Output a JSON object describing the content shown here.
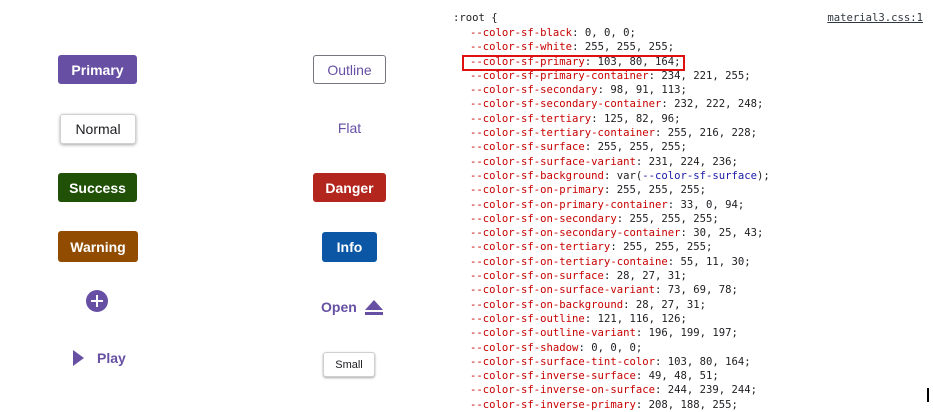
{
  "buttons": {
    "primary": "Primary",
    "normal": "Normal",
    "success": "Success",
    "warning": "Warning",
    "outline": "Outline",
    "flat": "Flat",
    "danger": "Danger",
    "info": "Info",
    "open": "Open",
    "play": "Play",
    "small": "Small"
  },
  "icons": {
    "add": "add-circle-icon",
    "play": "play-icon",
    "open": "eject-icon"
  },
  "colors": {
    "primary": "#6750a4",
    "success": "#205107",
    "warning": "#914c00",
    "danger": "#b3261e",
    "info": "#0b57a5"
  },
  "styles": {
    "selector": ":root {",
    "source": "material3.css:1",
    "highlighted_index": 2,
    "declarations": [
      {
        "prop": "--color-sf-black",
        "val": "0, 0, 0;"
      },
      {
        "prop": "--color-sf-white",
        "val": "255, 255, 255;"
      },
      {
        "prop": "--color-sf-primary",
        "val": "103, 80, 164;"
      },
      {
        "prop": "--color-sf-primary-container",
        "val": "234, 221, 255;"
      },
      {
        "prop": "--color-sf-secondary",
        "val": "98, 91, 113;"
      },
      {
        "prop": "--color-sf-secondary-container",
        "val": "232, 222, 248;"
      },
      {
        "prop": "--color-sf-tertiary",
        "val": "125, 82, 96;"
      },
      {
        "prop": "--color-sf-tertiary-container",
        "val": "255, 216, 228;"
      },
      {
        "prop": "--color-sf-surface",
        "val": "255, 255, 255;"
      },
      {
        "prop": "--color-sf-surface-variant",
        "val": "231, 224, 236;"
      },
      {
        "prop": "--color-sf-background",
        "val": "var(--color-sf-surface);"
      },
      {
        "prop": "--color-sf-on-primary",
        "val": "255, 255, 255;"
      },
      {
        "prop": "--color-sf-on-primary-container",
        "val": "33, 0, 94;"
      },
      {
        "prop": "--color-sf-on-secondary",
        "val": "255, 255, 255;"
      },
      {
        "prop": "--color-sf-on-secondary-container",
        "val": "30, 25, 43;"
      },
      {
        "prop": "--color-sf-on-tertiary",
        "val": "255, 255, 255;"
      },
      {
        "prop": "--color-sf-on-tertiary-containe",
        "val": "55, 11, 30;"
      },
      {
        "prop": "--color-sf-on-surface",
        "val": "28, 27, 31;"
      },
      {
        "prop": "--color-sf-on-surface-variant",
        "val": "73, 69, 78;"
      },
      {
        "prop": "--color-sf-on-background",
        "val": "28, 27, 31;"
      },
      {
        "prop": "--color-sf-outline",
        "val": "121, 116, 126;"
      },
      {
        "prop": "--color-sf-outline-variant",
        "val": "196, 199, 197;"
      },
      {
        "prop": "--color-sf-shadow",
        "val": "0, 0, 0;"
      },
      {
        "prop": "--color-sf-surface-tint-color",
        "val": "103, 80, 164;"
      },
      {
        "prop": "--color-sf-inverse-surface",
        "val": "49, 48, 51;"
      },
      {
        "prop": "--color-sf-inverse-on-surface",
        "val": "244, 239, 244;"
      },
      {
        "prop": "--color-sf-inverse-primary",
        "val": "208, 188, 255;"
      }
    ]
  }
}
